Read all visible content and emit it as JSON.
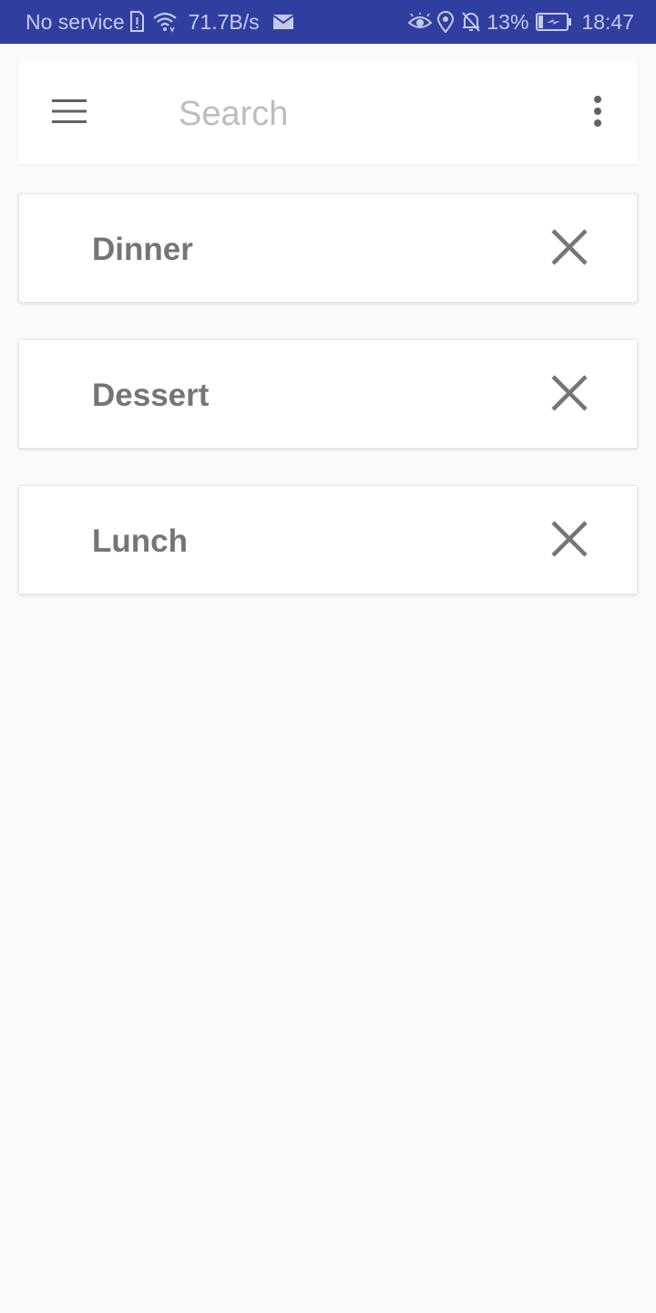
{
  "status_bar": {
    "carrier": "No service",
    "net_speed": "71.7B/s",
    "battery": "13%",
    "time": "18:47",
    "icons": [
      "sim-alert-icon",
      "wifi-icon",
      "mail-icon",
      "eye-icon",
      "location-icon",
      "notifications-off-icon",
      "battery-charging-icon"
    ]
  },
  "search": {
    "placeholder": "Search",
    "value": ""
  },
  "toolbar": {
    "menu_icon": "hamburger-menu-icon",
    "overflow_icon": "more-vert-icon"
  },
  "items": [
    {
      "label": "Dinner"
    },
    {
      "label": "Dessert"
    },
    {
      "label": "Lunch"
    }
  ],
  "colors": {
    "status_bar": "#303f9f",
    "status_text": "#c5cae9",
    "background": "#fafafa",
    "item_text": "#757575",
    "icon": "#757575"
  }
}
